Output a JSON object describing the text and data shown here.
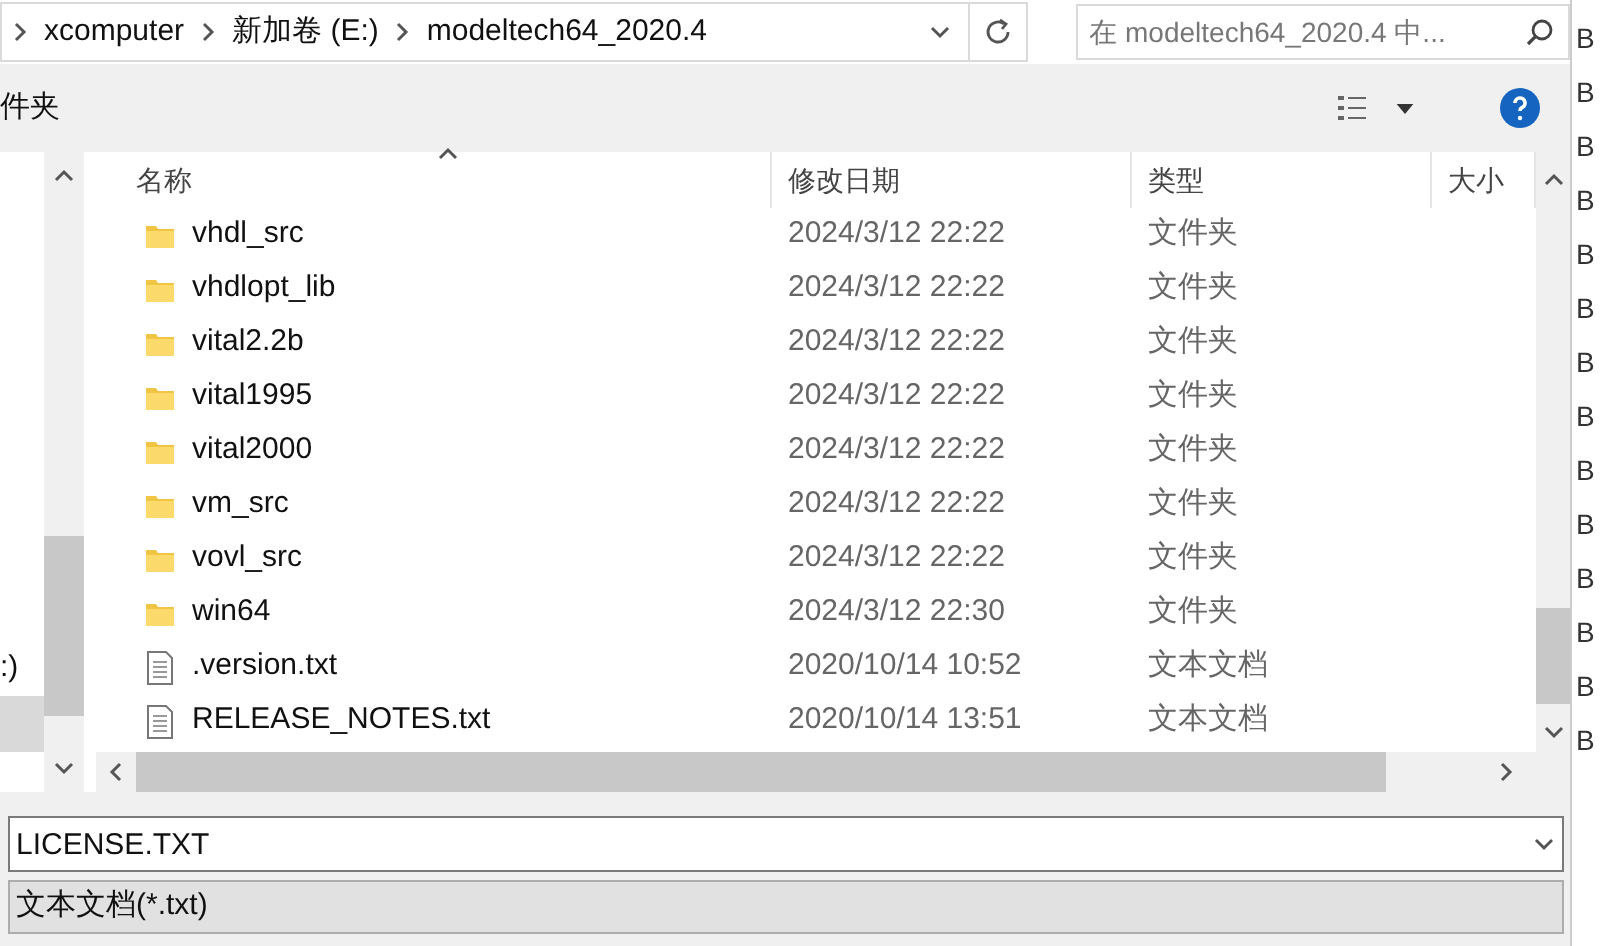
{
  "address_bar": {
    "breadcrumbs": [
      "xcomputer",
      "新加卷 (E:)",
      "modeltech64_2020.4"
    ]
  },
  "search": {
    "placeholder": "在 modeltech64_2020.4 中..."
  },
  "toolbar": {
    "new_folder_label": "件夹"
  },
  "nav_pane": {
    "items": [
      {
        "label": ":)",
        "selected": false
      },
      {
        "selected": true
      }
    ]
  },
  "table": {
    "columns": [
      "名称",
      "修改日期",
      "类型",
      "大小"
    ],
    "rows": [
      {
        "kind": "folder",
        "name": "vhdl_src",
        "date": "2024/3/12 22:22",
        "type": "文件夹"
      },
      {
        "kind": "folder",
        "name": "vhdlopt_lib",
        "date": "2024/3/12 22:22",
        "type": "文件夹"
      },
      {
        "kind": "folder",
        "name": "vital2.2b",
        "date": "2024/3/12 22:22",
        "type": "文件夹"
      },
      {
        "kind": "folder",
        "name": "vital1995",
        "date": "2024/3/12 22:22",
        "type": "文件夹"
      },
      {
        "kind": "folder",
        "name": "vital2000",
        "date": "2024/3/12 22:22",
        "type": "文件夹"
      },
      {
        "kind": "folder",
        "name": "vm_src",
        "date": "2024/3/12 22:22",
        "type": "文件夹"
      },
      {
        "kind": "folder",
        "name": "vovl_src",
        "date": "2024/3/12 22:22",
        "type": "文件夹"
      },
      {
        "kind": "folder",
        "name": "win64",
        "date": "2024/3/12 22:30",
        "type": "文件夹"
      },
      {
        "kind": "file",
        "name": ".version.txt",
        "date": "2020/10/14 10:52",
        "type": "文本文档"
      },
      {
        "kind": "file",
        "name": "RELEASE_NOTES.txt",
        "date": "2020/10/14 13:51",
        "type": "文本文档"
      }
    ]
  },
  "file_name": {
    "value": "LICENSE.TXT"
  },
  "file_type": {
    "value": "文本文档(*.txt)"
  },
  "background_window": {
    "edge_letters": [
      "B",
      "B",
      "B",
      "B",
      "B",
      "B",
      "B",
      "B",
      "B",
      "B",
      "B",
      "B",
      "B",
      "B"
    ]
  }
}
